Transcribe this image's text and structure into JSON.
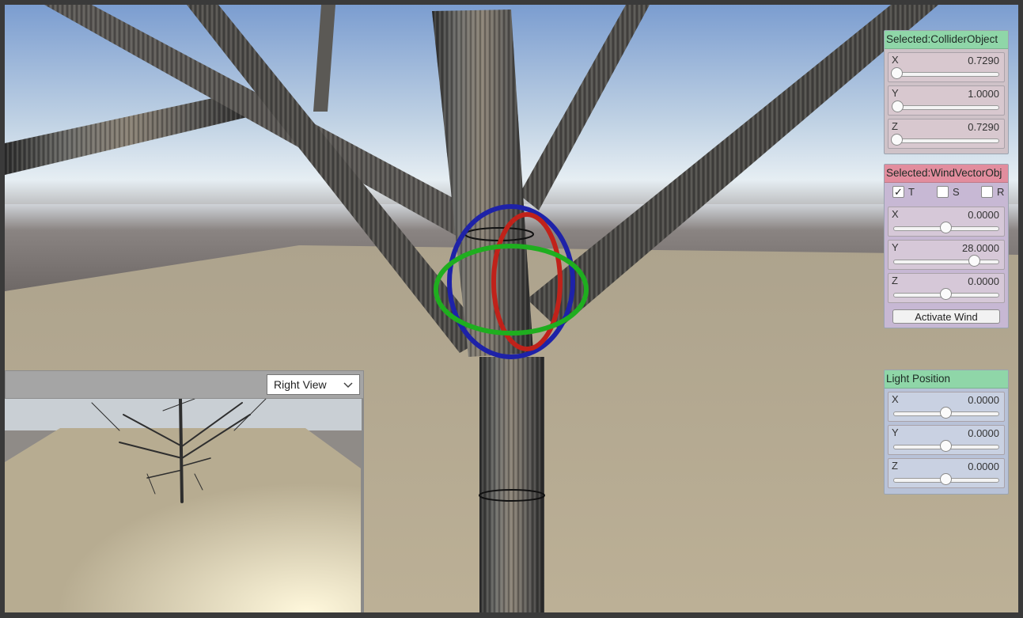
{
  "collider_panel": {
    "title": "Selected:ColliderObject",
    "sliders": [
      {
        "axis": "X",
        "value": "0.7290",
        "level": 0.03
      },
      {
        "axis": "Y",
        "value": "1.0000",
        "level": 0.04
      },
      {
        "axis": "Z",
        "value": "0.7290",
        "level": 0.03
      }
    ]
  },
  "wind_panel": {
    "title": "Selected:WindVectorObj",
    "toggles": [
      {
        "label": "T",
        "checked": true
      },
      {
        "label": "S",
        "checked": false
      },
      {
        "label": "R",
        "checked": false
      }
    ],
    "sliders": [
      {
        "axis": "X",
        "value": "0.0000",
        "level": 0.5
      },
      {
        "axis": "Y",
        "value": "28.0000",
        "level": 0.77
      },
      {
        "axis": "Z",
        "value": "0.0000",
        "level": 0.5
      }
    ],
    "button_label": "Activate Wind",
    "check_mark": "✓"
  },
  "light_panel": {
    "title": "Light Position",
    "sliders": [
      {
        "axis": "X",
        "value": "0.0000",
        "level": 0.5
      },
      {
        "axis": "Y",
        "value": "0.0000",
        "level": 0.5
      },
      {
        "axis": "Z",
        "value": "0.0000",
        "level": 0.5
      }
    ]
  },
  "mini_view": {
    "selected_view": "Right View",
    "chevron_icon": "chevron-down-icon"
  },
  "colors": {
    "sky_top": "#7d9fd1",
    "sky_horizon": "#dfe8ee",
    "floor": "#b8ac92",
    "bark": "#4a4a48",
    "gizmo_red": "#c0221a",
    "gizmo_green": "#1fae1f",
    "gizmo_blue": "#1e22a8"
  }
}
